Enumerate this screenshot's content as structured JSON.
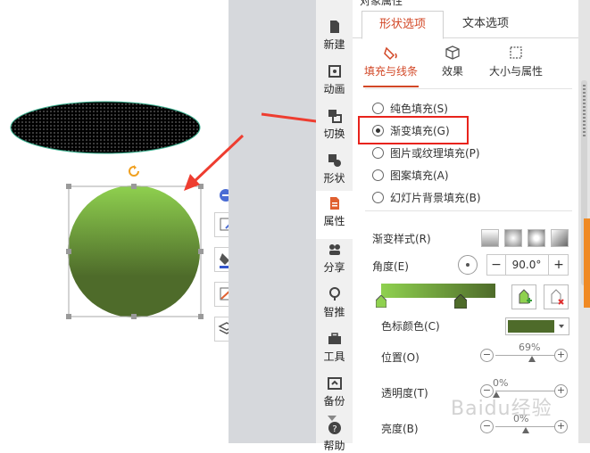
{
  "taskbar": {
    "items": [
      {
        "label": "新建",
        "icon": "new-file-icon"
      },
      {
        "label": "动画",
        "icon": "animation-icon"
      },
      {
        "label": "切换",
        "icon": "transition-icon"
      },
      {
        "label": "形状",
        "icon": "shapes-icon"
      },
      {
        "label": "属性",
        "icon": "properties-icon"
      },
      {
        "label": "分享",
        "icon": "share-icon"
      },
      {
        "label": "智推",
        "icon": "smart-push-icon"
      },
      {
        "label": "工具",
        "icon": "toolbox-icon"
      },
      {
        "label": "备份",
        "icon": "backup-icon"
      },
      {
        "label": "帮助",
        "icon": "help-icon"
      }
    ]
  },
  "panel": {
    "title": "对象属性",
    "tabs": [
      "形状选项",
      "文本选项"
    ],
    "subtabs": [
      "填充与线条",
      "效果",
      "大小与属性"
    ],
    "fill_options": [
      "纯色填充(S)",
      "渐变填充(G)",
      "图片或纹理填充(P)",
      "图案填充(A)",
      "幻灯片背景填充(B)"
    ],
    "selected_fill": "渐变填充(G)",
    "gradient_style_label": "渐变样式(R)",
    "angle_label": "角度(E)",
    "angle_value": "90.0°",
    "stop_color_label": "色标颜色(C)",
    "stop_color": "#4e6b2a",
    "position_label": "位置(O)",
    "position_value": "69%",
    "transparency_label": "透明度(T)",
    "transparency_value": "0%",
    "brightness_label": "亮度(B)",
    "brightness_value": "0%",
    "minus": "−",
    "plus": "+"
  },
  "colors": {
    "accent": "#d24726",
    "gradient_start": "#8fd14f",
    "gradient_end": "#4e6b2a",
    "highlight_box": "#e8231c"
  },
  "watermark": "Baidu经验"
}
